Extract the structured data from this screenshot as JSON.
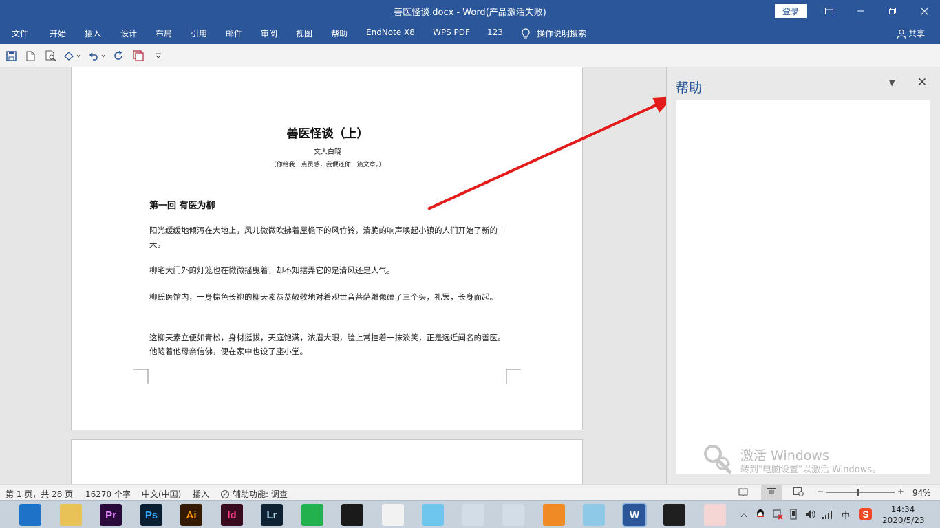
{
  "window": {
    "title": "善医怪谈.docx  -  Word(产品激活失败)",
    "login_label": "登录",
    "accent_color": "#2b579a"
  },
  "ribbon": {
    "tabs": [
      "文件",
      "开始",
      "插入",
      "设计",
      "布局",
      "引用",
      "邮件",
      "审阅",
      "视图",
      "帮助",
      "EndNote X8",
      "WPS PDF",
      "123"
    ],
    "tell_me": "操作说明搜索",
    "share": "共享"
  },
  "qat": {
    "icons": [
      "save-icon",
      "new-document-icon",
      "print-preview-icon",
      "touch-mode-icon",
      "undo-icon",
      "redo-icon",
      "window-icon",
      "customize-icon"
    ]
  },
  "document": {
    "title": "善医怪谈（上）",
    "author": "文人白晓",
    "note": "（你给我一点灵感，我便还你一篇文章。）",
    "heading": "第一回  有医为柳",
    "paragraphs": [
      "阳光缓缓地倾泻在大地上，风儿微微吹拂着屋檐下的风竹铃，清脆的响声唤起小镇的人们开始了新的一天。",
      "柳宅大门外的灯笼也在微微摇曳着，却不知摆弄它的是清风还是人气。",
      "柳氏医馆内，一身棕色长袍的柳天素恭恭敬敬地对着观世音菩萨雕像磕了三个头，礼罢，长身而起。",
      "这柳天素立便如青松，身材挺拔，天庭饱满，浓眉大眼，脸上常挂着一抹淡笑，正是远近闻名的善医。他随着他母亲信佛，便在家中也设了座小堂。"
    ]
  },
  "help_pane": {
    "title": "帮助"
  },
  "watermark": {
    "title": "激活 Windows",
    "subtitle": "转到\"电脑设置\"以激活 Windows。"
  },
  "statusbar": {
    "page": "第 1 页，共 28 页",
    "words": "16270 个字",
    "language": "中文(中国)",
    "mode": "插入",
    "accessibility": "辅助功能: 调查",
    "zoom": "94%",
    "zoom_minus": "−",
    "zoom_plus": "+"
  },
  "taskbar": {
    "apps": [
      {
        "name": "browser-icon",
        "label": "",
        "bg": "#1e73c8"
      },
      {
        "name": "file-explorer-icon",
        "label": "",
        "bg": "#e8c257"
      },
      {
        "name": "premiere-icon",
        "label": "Pr",
        "bg": "#2a0a3a",
        "fg": "#e58aff"
      },
      {
        "name": "photoshop-icon",
        "label": "Ps",
        "bg": "#0b1f33",
        "fg": "#31a8ff"
      },
      {
        "name": "illustrator-icon",
        "label": "Ai",
        "bg": "#331a00",
        "fg": "#ff9a00"
      },
      {
        "name": "indesign-icon",
        "label": "Id",
        "bg": "#3a0a1f",
        "fg": "#ff3e8a"
      },
      {
        "name": "lightroom-icon",
        "label": "Lr",
        "bg": "#0f2233",
        "fg": "#add5ec"
      },
      {
        "name": "green-app-icon",
        "label": "",
        "bg": "#22b14c"
      },
      {
        "name": "video-editor-icon",
        "label": "",
        "bg": "#1a1a1a"
      },
      {
        "name": "red-app-icon",
        "label": "",
        "bg": "#f2f2f2"
      },
      {
        "name": "cloud-app-icon",
        "label": "",
        "bg": "#6ec6ee"
      },
      {
        "name": "qq-icon",
        "label": "",
        "bg": "#d3dde7"
      },
      {
        "name": "chrome-icon",
        "label": "",
        "bg": "#d3dde7"
      },
      {
        "name": "orange-app-icon",
        "label": "",
        "bg": "#f08a24"
      },
      {
        "name": "notes-app-icon",
        "label": "",
        "bg": "#8fc9e8"
      },
      {
        "name": "word-icon",
        "label": "W",
        "bg": "#2b579a",
        "fg": "#ffffff"
      },
      {
        "name": "green-arrow-icon",
        "label": "",
        "bg": "#1f1f1f"
      },
      {
        "name": "avatar-app-icon",
        "label": "",
        "bg": "#f6d5d5"
      }
    ],
    "ime": "中",
    "time": "14:34",
    "date": "2020/5/23"
  }
}
